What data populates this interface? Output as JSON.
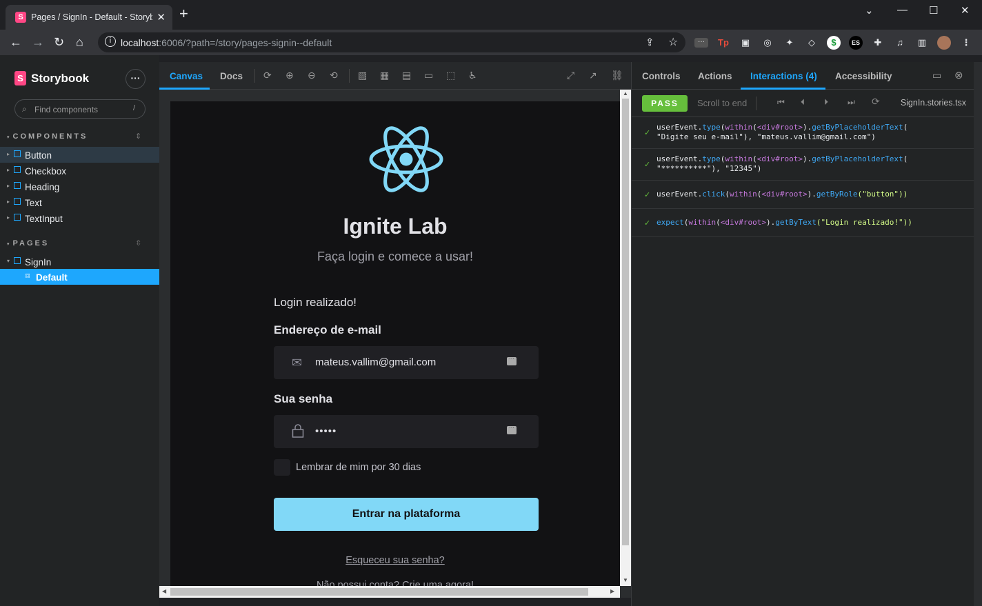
{
  "browser": {
    "tab_title": "Pages / SignIn - Default - Storybook",
    "url_host": "localhost",
    "url_rest": ":6006/?path=/story/pages-signin--default",
    "new_tab": "+",
    "tab_close": "✕"
  },
  "sidebar": {
    "brand": "Storybook",
    "search_placeholder": "Find components",
    "search_shortcut": "/",
    "sections": [
      {
        "title": "COMPONENTS",
        "items": [
          "Button",
          "Checkbox",
          "Heading",
          "Text",
          "TextInput"
        ]
      },
      {
        "title": "PAGES",
        "items": [
          "SignIn"
        ],
        "children": [
          "Default"
        ]
      }
    ]
  },
  "preview_toolbar": {
    "tabs": [
      "Canvas",
      "Docs"
    ],
    "active_tab": "Canvas"
  },
  "story": {
    "title": "Ignite Lab",
    "subtitle": "Faça login e comece a usar!",
    "message": "Login realizado!",
    "email_label": "Endereço de e-mail",
    "email_value": "mateus.vallim@gmail.com",
    "password_label": "Sua senha",
    "password_value": "•••••",
    "remember_label": "Lembrar de mim por 30 dias",
    "submit_label": "Entrar na plataforma",
    "forgot_link": "Esqueceu sua senha?",
    "signup_link": "Não possui conta? Crie uma agora!",
    "accent_color": "#81d8f7"
  },
  "addons": {
    "tabs": [
      "Controls",
      "Actions",
      "Interactions (4)",
      "Accessibility"
    ],
    "active_tab": "Interactions (4)",
    "status": "PASS",
    "scroll_to_end": "Scroll to end",
    "file": "SignIn.stories.tsx",
    "steps": [
      {
        "line1": [
          "userEvent",
          ".",
          "type",
          "(",
          "within",
          "(",
          "<div#root>",
          ")",
          ".",
          "getByPlaceholderText",
          "("
        ],
        "line2": "\"Digite seu e-mail\"), \"mateus.vallim@gmail.com\")"
      },
      {
        "line1": [
          "userEvent",
          ".",
          "type",
          "(",
          "within",
          "(",
          "<div#root>",
          ")",
          ".",
          "getByPlaceholderText",
          "("
        ],
        "line2": "\"**********\"), \"12345\")"
      },
      {
        "line1": [
          "userEvent",
          ".",
          "click",
          "(",
          "within",
          "(",
          "<div#root>",
          ")",
          ".",
          "getByRole",
          "(\"button\"))"
        ]
      },
      {
        "line1": [
          "expect",
          "(",
          "within",
          "(",
          "<div#root>",
          ")",
          ".",
          "getByText",
          "(\"Login realizado!\"))"
        ]
      }
    ]
  }
}
